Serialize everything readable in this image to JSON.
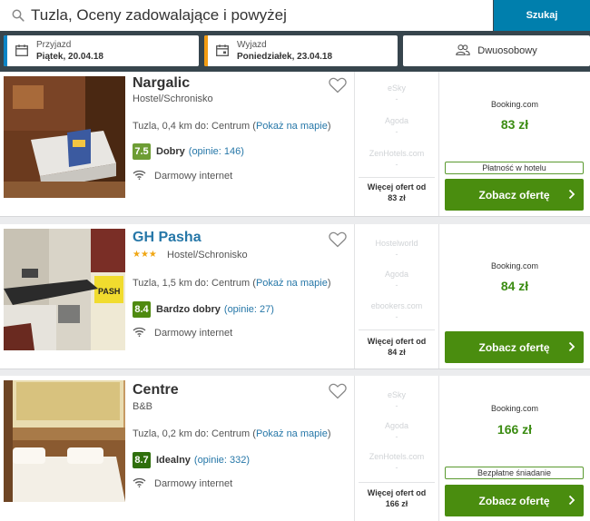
{
  "search": {
    "query": "Tuzla, Oceny zadowalające i powyżej",
    "button_label": "Szukaj"
  },
  "checkin": {
    "label": "Przyjazd",
    "value": "Piątek, 20.04.18",
    "accent": "#0a84c6"
  },
  "checkout": {
    "label": "Wyjazd",
    "value": "Poniedziałek, 23.04.18",
    "accent": "#f39c12"
  },
  "room": {
    "label": "Dwuosobowy",
    "icon": "users-icon"
  },
  "hotels": [
    {
      "name": "Nargalic",
      "type": "Hostel/Schronisko",
      "stars": "",
      "distance": "Tuzla, 0,4 km do: Centrum",
      "map_open": "(",
      "map_link": "Pokaż na mapie",
      "map_close": ")",
      "rating_score": "7.5",
      "rating_color": "#6d9d34",
      "rating_text": "Dobry",
      "reviews": "(opinie: 146)",
      "amenity": "Darmowy internet",
      "partners": [
        "eSky",
        "Agoda",
        "ZenHotels.com"
      ],
      "partner_dash": "-",
      "more_line1": "Więcej ofert od",
      "more_line2": "83 zł",
      "provider": "Booking.com",
      "price": "83 zł",
      "tag": "Płatność w hotelu",
      "cta": "Zobacz ofertę"
    },
    {
      "name": "GH Pasha",
      "type": "Hostel/Schronisko",
      "stars": "★★★",
      "distance": "Tuzla, 1,5 km do: Centrum",
      "map_open": "(",
      "map_link": "Pokaż na mapie",
      "map_close": ")",
      "rating_score": "8.4",
      "rating_color": "#4f8a10",
      "rating_text": "Bardzo dobry",
      "reviews": "(opinie: 27)",
      "amenity": "Darmowy internet",
      "partners": [
        "Hostelworld",
        "Agoda",
        "ebookers.com"
      ],
      "partner_dash": "-",
      "more_line1": "Więcej ofert od",
      "more_line2": "84 zł",
      "provider": "Booking.com",
      "price": "84 zł",
      "tag": "",
      "cta": "Zobacz ofertę"
    },
    {
      "name": "Centre",
      "type": "B&B",
      "stars": "",
      "distance": "Tuzla, 0,2 km do: Centrum",
      "map_open": "(",
      "map_link": "Pokaż na mapie",
      "map_close": ")",
      "rating_score": "8.7",
      "rating_color": "#2f6f0c",
      "rating_text": "Idealny",
      "reviews": "(opinie: 332)",
      "amenity": "Darmowy internet",
      "partners": [
        "eSky",
        "Agoda",
        "ZenHotels.com"
      ],
      "partner_dash": "-",
      "more_line1": "Więcej ofert od",
      "more_line2": "166 zł",
      "provider": "Booking.com",
      "price": "166 zł",
      "tag": "Bezpłatne śniadanie",
      "cta": "Zobacz ofertę"
    }
  ]
}
